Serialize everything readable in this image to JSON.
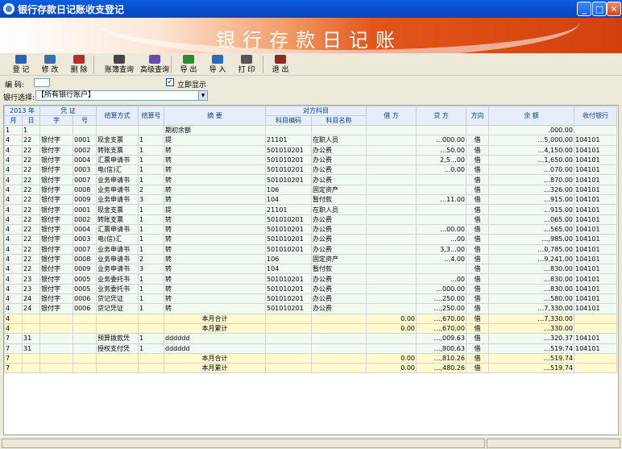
{
  "window": {
    "title": "银行存款日记账收支登记"
  },
  "banner": {
    "title": "银行存款日记账"
  },
  "toolbar": [
    {
      "name": "tb-register",
      "label": "登 记",
      "icon": "register-icon"
    },
    {
      "name": "tb-edit",
      "label": "修 改",
      "icon": "edit-icon"
    },
    {
      "name": "tb-delete",
      "label": "删 除",
      "icon": "delete-icon"
    },
    {
      "name": "tb-account-query",
      "label": "账簿查询",
      "icon": "binoculars-icon"
    },
    {
      "name": "tb-advanced-query",
      "label": "高级查询",
      "icon": "advanced-query-icon"
    },
    {
      "name": "tb-export",
      "label": "导 出",
      "icon": "export-icon"
    },
    {
      "name": "tb-import",
      "label": "导 入",
      "icon": "import-icon"
    },
    {
      "name": "tb-print",
      "label": "打 印",
      "icon": "printer-icon"
    },
    {
      "name": "tb-exit",
      "label": "退 出",
      "icon": "exit-icon"
    }
  ],
  "form": {
    "code_label": "编 码:",
    "show_now_label": "立即显示",
    "show_now_checked": true,
    "bank_select_label": "银行选择:",
    "bank_select_value": "【所有银行账户】"
  },
  "table": {
    "header_top": [
      "2013 年",
      "凭 证",
      "结算方式",
      "结算号",
      "摘 要",
      "对方科目",
      "借 方",
      "贷 方",
      "方向",
      "余 额",
      "收付银行"
    ],
    "header_sub": [
      "月",
      "日",
      "字",
      "号",
      "科目编码",
      "科目名称"
    ],
    "rows": [
      {
        "c": [
          "1",
          "1",
          "",
          "",
          "",
          "",
          "期初余额",
          "",
          "",
          "",
          "",
          "",
          "",
          ".000.00",
          ""
        ],
        "type": "green"
      },
      {
        "c": [
          "4",
          "22",
          "银付字",
          "0001",
          "现金支票",
          "1",
          "提",
          "21101",
          "在职人员",
          "",
          "…000.00",
          "借",
          "…5,000.00",
          "104101"
        ],
        "type": "green"
      },
      {
        "c": [
          "4",
          "22",
          "银付字",
          "0002",
          "转账支票",
          "1",
          "转",
          "501010201",
          "办公费",
          "",
          "…50.00",
          "借",
          "…4,150.00",
          "104101"
        ],
        "type": "green"
      },
      {
        "c": [
          "4",
          "22",
          "银付字",
          "0004",
          "汇票申请书",
          "1",
          "转",
          "501010201",
          "办公费",
          "",
          "2,5…00",
          "借",
          "…1,650.00",
          "104101"
        ],
        "type": "green"
      },
      {
        "c": [
          "4",
          "22",
          "银付字",
          "0003",
          "电(信)汇",
          "1",
          "转",
          "501010201",
          "办公费",
          "",
          "…0.00",
          "借",
          "…070.00",
          "104101"
        ],
        "type": "green"
      },
      {
        "c": [
          "4",
          "22",
          "银付字",
          "0007",
          "业务申请书",
          "1",
          "转",
          "501010201",
          "办公费",
          "",
          "",
          "借",
          "…870.00",
          "104101"
        ],
        "type": "green"
      },
      {
        "c": [
          "4",
          "22",
          "银付字",
          "0008",
          "业务申请书",
          "2",
          "转",
          "106",
          "固定资产",
          "",
          "",
          "借",
          "…326.00",
          "104101"
        ],
        "type": "green"
      },
      {
        "c": [
          "4",
          "22",
          "银付字",
          "0009",
          "业务申请书",
          "3",
          "转",
          "104",
          "暂付款",
          "",
          "…11.00",
          "借",
          "…915.00",
          "104101"
        ],
        "type": "green"
      },
      {
        "c": [
          "4",
          "22",
          "银付字",
          "0001",
          "现金支票",
          "1",
          "提",
          "21101",
          "在职人员",
          "",
          "",
          "借",
          "…915.00",
          "104101"
        ],
        "type": "green"
      },
      {
        "c": [
          "4",
          "22",
          "银付字",
          "0002",
          "转账支票",
          "1",
          "转",
          "501010201",
          "办公费",
          "",
          "",
          "借",
          "…065.00",
          "104101"
        ],
        "type": "green"
      },
      {
        "c": [
          "4",
          "22",
          "银付字",
          "0004",
          "汇票申请书",
          "1",
          "转",
          "501010201",
          "办公费",
          "",
          "…00.00",
          "借",
          "…565.00",
          "104101"
        ],
        "type": "green"
      },
      {
        "c": [
          "4",
          "22",
          "银付字",
          "0003",
          "电(信)汇",
          "1",
          "转",
          "501010201",
          "办公费",
          "",
          "…00",
          "借",
          "…,985.00",
          "104101"
        ],
        "type": "green"
      },
      {
        "c": [
          "4",
          "22",
          "银付字",
          "0007",
          "业务申请书",
          "1",
          "转",
          "501010201",
          "办公费",
          "",
          "3,3…00",
          "借",
          "…0,785.00",
          "104101"
        ],
        "type": "green"
      },
      {
        "c": [
          "4",
          "22",
          "银付字",
          "0008",
          "业务申请书",
          "2",
          "转",
          "106",
          "固定资产",
          "",
          "…4.00",
          "借",
          "…9,241.00",
          "104101"
        ],
        "type": "green"
      },
      {
        "c": [
          "4",
          "22",
          "银付字",
          "0009",
          "业务申请书",
          "3",
          "转",
          "104",
          "暂付款",
          "",
          "",
          "借",
          "…830.00",
          "104101"
        ],
        "type": "green"
      },
      {
        "c": [
          "4",
          "23",
          "银付字",
          "0005",
          "业务委托书",
          "1",
          "转",
          "501010201",
          "办公费",
          "",
          "…00",
          "借",
          "…830.00",
          "104101"
        ],
        "type": "green"
      },
      {
        "c": [
          "4",
          "23",
          "银付字",
          "0005",
          "业务委托书",
          "1",
          "转",
          "501010201",
          "办公费",
          "",
          "…000.00",
          "借",
          "…830.00",
          "104101"
        ],
        "type": "green"
      },
      {
        "c": [
          "4",
          "24",
          "银付字",
          "0006",
          "贷记凭证",
          "1",
          "转",
          "501010201",
          "办公费",
          "",
          "…,250.00",
          "借",
          "…580.00",
          "104101"
        ],
        "type": "green"
      },
      {
        "c": [
          "4",
          "24",
          "银付字",
          "0006",
          "贷记凭证",
          "1",
          "转",
          "501010201",
          "办公费",
          "",
          "…,250.00",
          "借",
          "…7,330.00",
          "104101"
        ],
        "type": "green"
      },
      {
        "c": [
          "4",
          "",
          "",
          "",
          "",
          "",
          "本月合计",
          "",
          "",
          "0.00",
          "…,670.00",
          "借",
          "…7,330.00",
          ""
        ],
        "type": "total"
      },
      {
        "c": [
          "4",
          "",
          "",
          "",
          "",
          "",
          "本月累计",
          "",
          "",
          "0.00",
          "…,670.00",
          "借",
          "…330.00",
          ""
        ],
        "type": "total"
      },
      {
        "c": [
          "7",
          "31",
          "",
          "",
          "预算拨款凭",
          "1",
          "dddddd",
          "",
          "",
          "",
          "…,009.63",
          "借",
          "…320.37",
          "104101"
        ],
        "type": "green"
      },
      {
        "c": [
          "7",
          "31",
          "",
          "",
          "授权支付凭",
          "1",
          "dddddd",
          "",
          "",
          "",
          "…,800.63",
          "借",
          "…519.74",
          "104101"
        ],
        "type": "green"
      },
      {
        "c": [
          "7",
          "",
          "",
          "",
          "",
          "",
          "本月合计",
          "",
          "",
          "0.00",
          "…,810.26",
          "借",
          "…519.74",
          ""
        ],
        "type": "total"
      },
      {
        "c": [
          "7",
          "",
          "",
          "",
          "",
          "",
          "本月累计",
          "",
          "",
          "0.00",
          "…,480.26",
          "借",
          "…519.74",
          ""
        ],
        "type": "total"
      }
    ]
  }
}
